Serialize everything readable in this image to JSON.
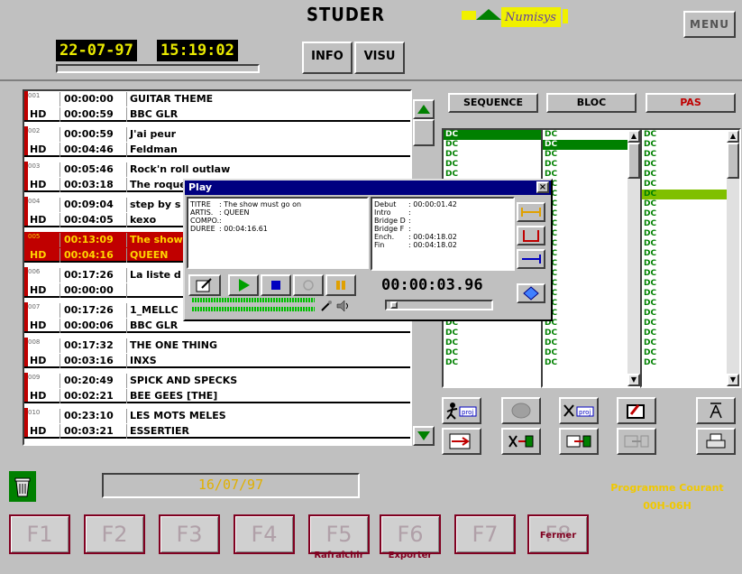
{
  "header": {
    "date": "22-07-97",
    "time": "15:19:02",
    "info_label": "INFO",
    "visu_label": "VISU",
    "brand": "STUDER",
    "logo_text": "Numisys",
    "menu_label": "MENU"
  },
  "playlist": {
    "entries": [
      {
        "num": "001",
        "type": "HD",
        "start": "00:00:00",
        "duration": "00:00:59",
        "title": "GUITAR THEME",
        "artist": "BBC GLR",
        "selected": false
      },
      {
        "num": "002",
        "type": "HD",
        "start": "00:00:59",
        "duration": "00:04:46",
        "title": "J'ai peur",
        "artist": "Feldman",
        "selected": false
      },
      {
        "num": "003",
        "type": "HD",
        "start": "00:05:46",
        "duration": "00:03:18",
        "title": "Rock'n roll outlaw",
        "artist": "The roque",
        "selected": false
      },
      {
        "num": "004",
        "type": "HD",
        "start": "00:09:04",
        "duration": "00:04:05",
        "title": "step by s",
        "artist": "kexo",
        "selected": false
      },
      {
        "num": "005",
        "type": "HD",
        "start": "00:13:09",
        "duration": "00:04:16",
        "title": "The show",
        "artist": "QUEEN",
        "selected": true
      },
      {
        "num": "006",
        "type": "HD",
        "start": "00:17:26",
        "duration": "00:00:00",
        "title": "La liste d",
        "artist": "",
        "selected": false
      },
      {
        "num": "007",
        "type": "HD",
        "start": "00:17:26",
        "duration": "00:00:06",
        "title": "1_MELLC",
        "artist": "BBC GLR",
        "selected": false
      },
      {
        "num": "008",
        "type": "HD",
        "start": "00:17:32",
        "duration": "00:03:16",
        "title": "THE ONE THING",
        "artist": "INXS",
        "selected": false
      },
      {
        "num": "009",
        "type": "HD",
        "start": "00:20:49",
        "duration": "00:02:21",
        "title": "SPICK AND SPECKS",
        "artist": "BEE GEES [THE]",
        "selected": false
      },
      {
        "num": "010",
        "type": "HD",
        "start": "00:23:10",
        "duration": "00:03:21",
        "title": "LES MOTS MELES",
        "artist": "ESSERTIER",
        "selected": false
      }
    ]
  },
  "tabs": {
    "sequence": "SEQUENCE",
    "bloc": "BLOC",
    "pas": "PAS"
  },
  "columns": {
    "dc_label": "DC"
  },
  "play_dialog": {
    "title": "Play",
    "close": "×",
    "titre_key": "TITRE",
    "titre_val": ": The show must go on",
    "artis_key": "ARTIS.",
    "artis_val": ": QUEEN",
    "compo_key": "COMPO.",
    "compo_val": ":",
    "duree_key": "DUREE",
    "duree_val": ": 00:04:16.61",
    "debut_key": "Debut",
    "debut_val": ": 00:00:01.42",
    "intro_key": "Intro",
    "intro_val": ":",
    "bridged_key": "Bridge D",
    "bridged_val": ":",
    "bridgef_key": "Bridge F",
    "bridgef_val": ":",
    "ench_key": "Ench.",
    "ench_val": ": 00:04:18.02",
    "fin_key": "Fin",
    "fin_val": ": 00:04:18.02",
    "timecode": "00:00:03.96"
  },
  "bottom": {
    "date": "16/07/97",
    "programme_label": "Programme Courant",
    "programme_value": "00H-06H",
    "fkeys": [
      {
        "label": "F1",
        "sub": ""
      },
      {
        "label": "F2",
        "sub": ""
      },
      {
        "label": "F3",
        "sub": ""
      },
      {
        "label": "F4",
        "sub": ""
      },
      {
        "label": "F5",
        "sub": "Rafraîchir"
      },
      {
        "label": "F6",
        "sub": "Exporter"
      },
      {
        "label": "F7",
        "sub": ""
      },
      {
        "label": "F8",
        "sub": "Fermer"
      }
    ]
  },
  "colors": {
    "selected_row": "#c00000",
    "selected_text": "#ffd400",
    "title_bar": "#000080",
    "dc_green": "#008000",
    "pas_red": "#c00000"
  }
}
